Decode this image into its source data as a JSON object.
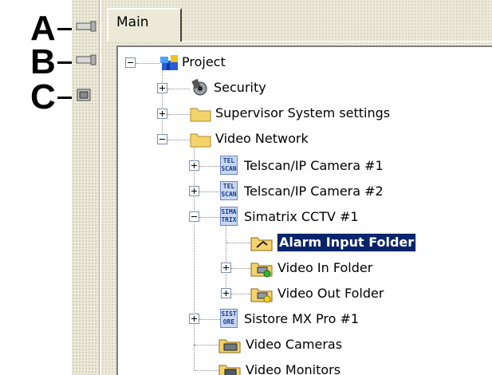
{
  "annotations": {
    "a": "A",
    "b": "B",
    "c": "C"
  },
  "tabs": {
    "main": "Main"
  },
  "tree": {
    "project": "Project",
    "security": "Security",
    "supervisor": "Supervisor System settings",
    "video_network": "Video Network",
    "telscan1": "Telscan/IP Camera #1",
    "telscan2": "Telscan/IP Camera #2",
    "simatrix": "Simatrix CCTV #1",
    "alarm_input": "Alarm Input Folder",
    "video_in": "Video In Folder",
    "video_out": "Video Out Folder",
    "sistore": "Sistore MX Pro #1",
    "video_cameras": "Video Cameras",
    "video_monitors": "Video Monitors"
  },
  "badges": {
    "telscan": "TEL SCAN",
    "simatrix": "SIMA TRIX",
    "sistore": "SIST ORE"
  },
  "colors": {
    "selection": "#0a246a",
    "folder": "#f5d36b",
    "panel": "#ece9d8"
  }
}
